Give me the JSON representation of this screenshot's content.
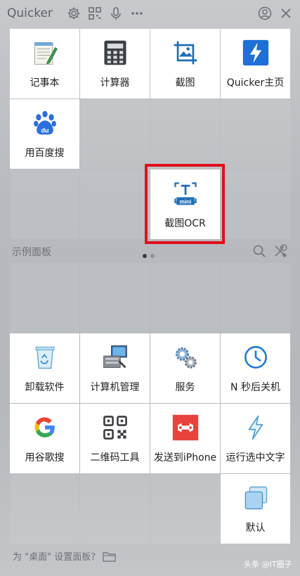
{
  "app": {
    "title": "Quicker"
  },
  "titlebar": {
    "icons": [
      "gear-icon",
      "qrcode-icon",
      "mic-icon",
      "more-icon",
      "user-icon",
      "close-icon"
    ]
  },
  "top_panel": {
    "items": [
      {
        "label": "记事本",
        "icon": "notepad-icon"
      },
      {
        "label": "计算器",
        "icon": "calculator-icon"
      },
      {
        "label": "截图",
        "icon": "screenshot-icon"
      },
      {
        "label": "Quicker主页",
        "icon": "quicker-bolt-icon"
      },
      {
        "label": "用百度搜",
        "icon": "baidu-paw-icon"
      },
      {
        "label": "截图OCR",
        "icon": "ocr-mini-icon"
      }
    ]
  },
  "pager": {
    "active_index": 0,
    "count": 2
  },
  "section": {
    "title": "示例面板"
  },
  "bottom_panel": {
    "items": [
      {
        "label": "卸载软件",
        "icon": "recycle-bin-icon"
      },
      {
        "label": "计算机管理",
        "icon": "computer-manage-icon"
      },
      {
        "label": "服务",
        "icon": "gears-icon"
      },
      {
        "label": "N 秒后关机",
        "icon": "clock-icon"
      },
      {
        "label": "用谷歌搜",
        "icon": "google-icon"
      },
      {
        "label": "二维码工具",
        "icon": "qrcode-tool-icon"
      },
      {
        "label": "发送到iPhone",
        "icon": "send-iphone-icon"
      },
      {
        "label": "运行选中文字",
        "icon": "run-bolt-icon"
      },
      {
        "label": "默认",
        "icon": "default-window-icon"
      }
    ]
  },
  "footer": {
    "hint": "为 \"桌面\" 设置面板?"
  },
  "watermark": "头条 @IT圈子",
  "colors": {
    "highlight": "#e0101b",
    "accent_blue": "#1e7ad6"
  }
}
